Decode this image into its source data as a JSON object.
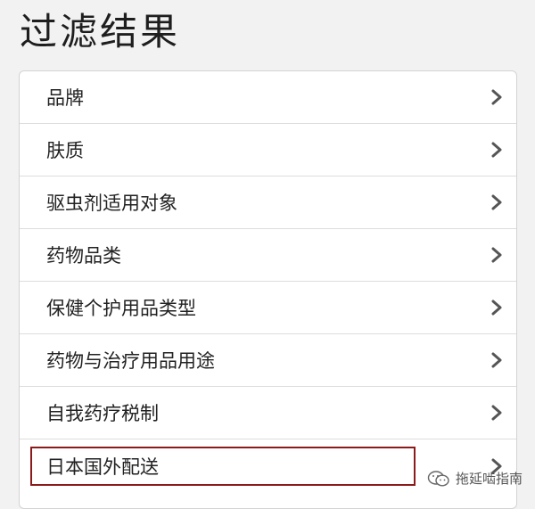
{
  "page_title": "过滤结果",
  "filters": [
    {
      "label": "品牌"
    },
    {
      "label": "肤质"
    },
    {
      "label": "驱虫剂适用对象"
    },
    {
      "label": "药物品类"
    },
    {
      "label": "保健个护用品类型"
    },
    {
      "label": "药物与治疗用品用途"
    },
    {
      "label": "自我药疗税制"
    },
    {
      "label": "日本国外配送",
      "highlighted": true
    }
  ],
  "watermark": {
    "text": "拖延啮指南",
    "icon": "wechat-icon"
  },
  "colors": {
    "highlight_border": "#8b1a1a",
    "chevron": "#555555"
  }
}
